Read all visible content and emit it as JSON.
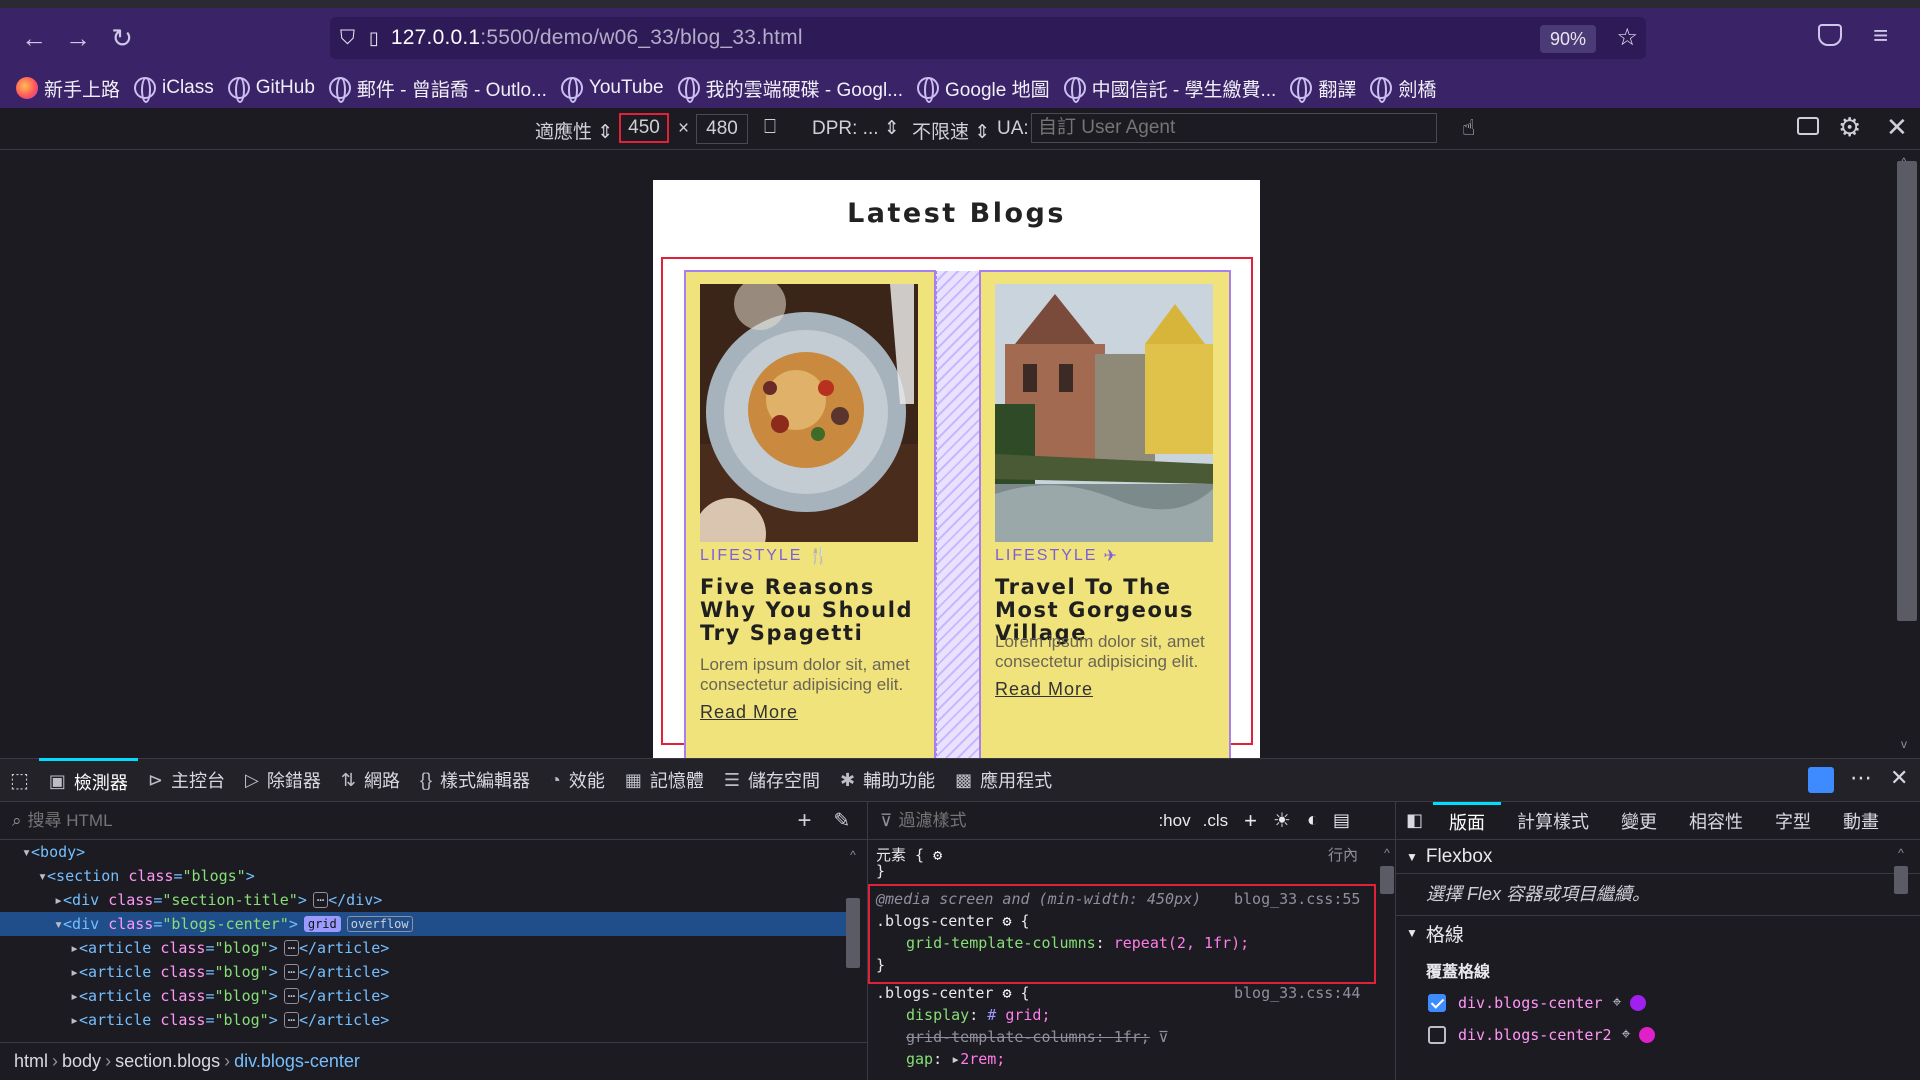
{
  "browser": {
    "url_host": "127.0.0.1",
    "url_path": ":5500/demo/w06_33/blog_33.html",
    "zoom": "90%",
    "bookmarks": [
      "新手上路",
      "iClass",
      "GitHub",
      "郵件 - 曾詣喬 - Outlo...",
      "YouTube",
      "我的雲端硬碟 - Googl...",
      "Google 地圖",
      "中國信託 - 學生繳費...",
      "翻譯",
      "劍橋"
    ]
  },
  "rdm": {
    "device": "適應性",
    "width": "450",
    "times": "×",
    "height": "480",
    "dpr": "DPR: ...",
    "throttle": "不限速",
    "ua_label": "UA:",
    "ua_placeholder": "自訂 User Agent"
  },
  "page": {
    "title": "Latest Blogs",
    "cards": [
      {
        "category": "LIFESTYLE",
        "title": "Five Reasons Why You Should Try Spagetti",
        "text": "Lorem ipsum dolor sit, amet consectetur adipisicing elit.",
        "link": "Read More"
      },
      {
        "category": "LIFESTYLE",
        "title": "Travel To The Most Gorgeous Village",
        "text": "Lorem ipsum dolor sit, amet consectetur adipisicing elit.",
        "link": "Read More"
      }
    ]
  },
  "devtools": {
    "tabs": [
      "檢測器",
      "主控台",
      "除錯器",
      "網路",
      "樣式編輯器",
      "效能",
      "記憶體",
      "儲存空間",
      "輔助功能",
      "應用程式"
    ],
    "search_placeholder": "搜尋 HTML",
    "tree": [
      {
        "indent": 0,
        "open": true,
        "html": [
          "<body>"
        ]
      },
      {
        "indent": 1,
        "open": true,
        "tag": "section",
        "cls": "blogs"
      },
      {
        "indent": 2,
        "open": false,
        "tag": "div",
        "cls": "section-title",
        "collapsed": true
      },
      {
        "indent": 2,
        "open": true,
        "tag": "div",
        "cls": "blogs-center",
        "selected": true,
        "badges": [
          "grid",
          "overflow"
        ]
      },
      {
        "indent": 3,
        "open": false,
        "tag": "article",
        "cls": "blog",
        "collapsed": true
      },
      {
        "indent": 3,
        "open": false,
        "tag": "article",
        "cls": "blog",
        "collapsed": true
      },
      {
        "indent": 3,
        "open": false,
        "tag": "article",
        "cls": "blog",
        "collapsed": true
      },
      {
        "indent": 3,
        "open": false,
        "tag": "article",
        "cls": "blog",
        "collapsed": true
      }
    ],
    "breadcrumb": [
      "html",
      "body",
      "section.blogs",
      "div.blogs-center"
    ],
    "rules_filter": "過濾樣式",
    "rules_buttons": [
      ":hov",
      ".cls"
    ],
    "element_rule": "元素 {",
    "inline": "行內",
    "media_rule": "@media screen and (min-width: 450px)",
    "media_src": "blog_33.css:55",
    "media_selector": ".blogs-center",
    "media_prop": "grid-template-columns",
    "media_val": "repeat(2, 1fr);",
    "base_selector": ".blogs-center",
    "base_src": "blog_33.css:44",
    "base_props": [
      {
        "name": "display",
        "value": "grid;"
      },
      {
        "name": "grid-template-columns",
        "value": "1fr;",
        "struck": true
      },
      {
        "name": "gap",
        "value": "2rem;"
      }
    ],
    "layout_tabs": [
      "版面",
      "計算樣式",
      "變更",
      "相容性",
      "字型",
      "動畫"
    ],
    "flexbox_title": "Flexbox",
    "flexbox_hint": "選擇 Flex 容器或項目繼續。",
    "grid_title": "格線",
    "overlay_title": "覆蓋格線",
    "overlays": [
      {
        "name": "div.blogs-center",
        "checked": true,
        "color": "#a020f0"
      },
      {
        "name": "div.blogs-center2",
        "checked": false,
        "color": "#e020c8"
      }
    ]
  },
  "colors": {
    "accent": "#00ddff",
    "card": "#f1e37c",
    "grid_outline": "#e0213a",
    "toolbar": "#3a2467"
  }
}
